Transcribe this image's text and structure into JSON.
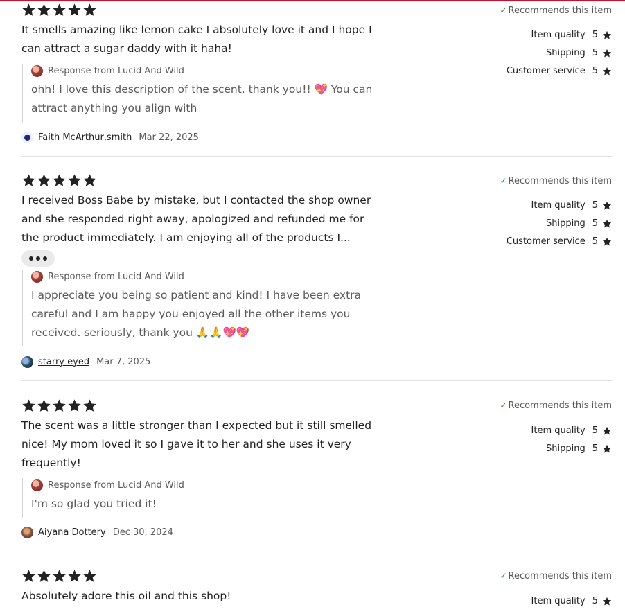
{
  "colors": {
    "accent_top_line": "#c8102e",
    "check": "#258635",
    "text": "#222222",
    "muted": "#595959",
    "divider": "#e1e1e1"
  },
  "icons": {
    "star": "star-icon",
    "check": "check-icon",
    "more": "more-icon"
  },
  "recommends_label": "Recommends this item",
  "response_label": "Response from Lucid And Wild",
  "labels": {
    "item_quality": "Item quality",
    "shipping": "Shipping",
    "customer_service": "Customer service"
  },
  "reviews": [
    {
      "stars": 5,
      "text": "It smells amazing like lemon cake I absolutely love it and I hope I can attract a sugar daddy with it haha!",
      "ratings": {
        "item_quality": "5",
        "shipping": "5",
        "customer_service": "5"
      },
      "response": "ohh! I love this description of the scent. thank you!! 💖 You can attract anything you align with",
      "reviewer": "Faith McArthur,smith",
      "date": "Mar 22, 2025"
    },
    {
      "stars": 5,
      "text": "I received Boss Babe by mistake, but I contacted the shop owner and she responded right away, apologized and refunded me for the product immediately. I am enjoying all of the products I...",
      "ratings": {
        "item_quality": "5",
        "shipping": "5",
        "customer_service": "5"
      },
      "response": "I appreciate you being so patient and kind! I have been extra careful and I am happy you enjoyed all the other items you received. seriously, thank you 🙏🙏💖💖",
      "reviewer": "starry eyed",
      "date": "Mar 7, 2025"
    },
    {
      "stars": 5,
      "text": "The scent was a little stronger than I expected but it still smelled nice! My mom loved it so I gave it to her and she uses it very frequently!",
      "ratings": {
        "item_quality": "5",
        "shipping": "5"
      },
      "response": "I'm so glad you tried it!",
      "reviewer": "Aiyana Dottery",
      "date": "Dec 30, 2024"
    },
    {
      "stars": 5,
      "text": "Absolutely adore this oil and this shop!",
      "ratings": {
        "item_quality": "5"
      }
    }
  ]
}
